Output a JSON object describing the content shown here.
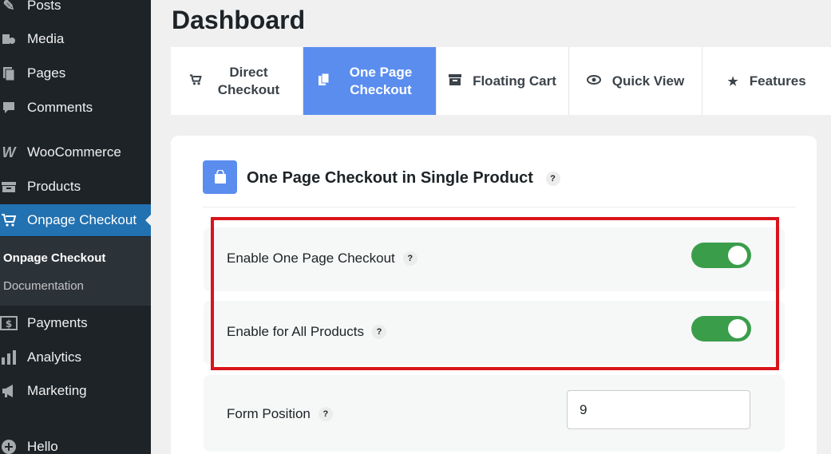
{
  "sidebar": {
    "items": [
      {
        "label": "Posts",
        "icon": "pin-icon"
      },
      {
        "label": "Media",
        "icon": "media-icon"
      },
      {
        "label": "Pages",
        "icon": "pages-icon"
      },
      {
        "label": "Comments",
        "icon": "comments-icon"
      },
      {
        "label": "WooCommerce",
        "icon": "woocommerce-icon"
      },
      {
        "label": "Products",
        "icon": "products-icon"
      },
      {
        "label": "Onpage Checkout",
        "icon": "cart-icon"
      },
      {
        "label": "Payments",
        "icon": "payments-icon"
      },
      {
        "label": "Analytics",
        "icon": "analytics-icon"
      },
      {
        "label": "Marketing",
        "icon": "megaphone-icon"
      },
      {
        "label": "Hello",
        "icon": "plus-circle-icon"
      }
    ],
    "submenu": [
      {
        "label": "Onpage Checkout"
      },
      {
        "label": "Documentation"
      }
    ]
  },
  "page": {
    "title": "Dashboard"
  },
  "tabs": [
    {
      "label": "Direct Checkout",
      "icon": "cart-icon"
    },
    {
      "label": "One Page Checkout",
      "icon": "copy-icon"
    },
    {
      "label": "Floating Cart",
      "icon": "archive-icon"
    },
    {
      "label": "Quick View",
      "icon": "eye-icon"
    },
    {
      "label": "Features",
      "icon": "star-icon"
    }
  ],
  "section": {
    "title": "One Page Checkout in Single Product",
    "help": "?",
    "settings": [
      {
        "label": "Enable One Page Checkout",
        "type": "toggle",
        "enabled": true
      },
      {
        "label": "Enable for All Products",
        "type": "toggle",
        "enabled": true
      },
      {
        "label": "Form Position",
        "type": "number",
        "value": "9"
      }
    ]
  },
  "colors": {
    "accent": "#5b8def",
    "toggle_on": "#3a9d4a",
    "sidebar": "#1d2327",
    "highlight": "#d9141b",
    "active_menu": "#2271b1"
  }
}
